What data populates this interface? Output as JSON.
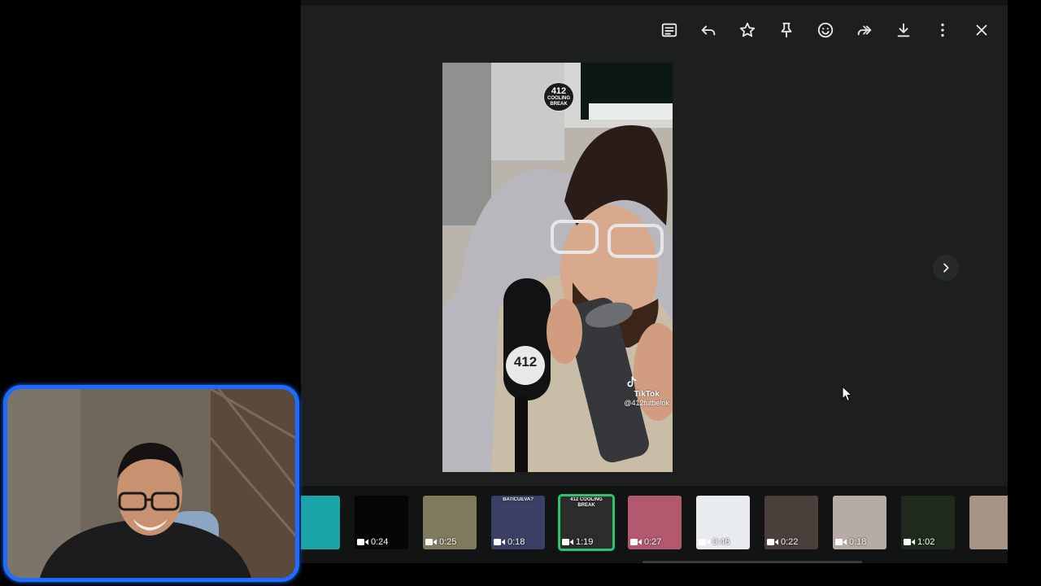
{
  "toolbar": {
    "items": [
      {
        "name": "caption-icon",
        "label": "Caption"
      },
      {
        "name": "reply-icon",
        "label": "Reply"
      },
      {
        "name": "star-icon",
        "label": "Star"
      },
      {
        "name": "pin-icon",
        "label": "Pin"
      },
      {
        "name": "react-icon",
        "label": "React"
      },
      {
        "name": "forward-icon",
        "label": "Forward"
      },
      {
        "name": "download-icon",
        "label": "Download"
      },
      {
        "name": "more-icon",
        "label": "More options"
      },
      {
        "name": "close-icon",
        "label": "Close"
      }
    ]
  },
  "main_video": {
    "logo_number": "412",
    "logo_text": "COOLING BREAK",
    "mic_label": "412",
    "watermark_brand": "TikTok",
    "watermark_handle": "@412futbelok"
  },
  "thumbnails": [
    {
      "duration": "",
      "caption": "",
      "bg": "#1aa6a8"
    },
    {
      "duration": "0:24",
      "caption": "",
      "bg": "#050505"
    },
    {
      "duration": "0:25",
      "caption": "",
      "bg": "#7f7a5d"
    },
    {
      "duration": "0:18",
      "caption": "BATICUEVA?",
      "bg": "#3a3f66"
    },
    {
      "duration": "1:19",
      "caption": "412 COOLING BREAK",
      "bg": "#2c2c2c",
      "selected": true
    },
    {
      "duration": "0:27",
      "caption": "",
      "bg": "#b2586f"
    },
    {
      "duration": "0:46",
      "caption": "",
      "bg": "#e9ecef"
    },
    {
      "duration": "0:22",
      "caption": "",
      "bg": "#4a3f3b"
    },
    {
      "duration": "0:18",
      "caption": "",
      "bg": "#b6aca3"
    },
    {
      "duration": "1:02",
      "caption": "",
      "bg": "#1f2a1c"
    },
    {
      "duration": "",
      "caption": "",
      "bg": "#a79485"
    },
    {
      "duration": "",
      "caption": "",
      "bg": "#3c3f62"
    }
  ],
  "colors": {
    "viewer_bg": "#1c1f1e",
    "selected_outline": "#28c76f",
    "webcam_border": "#1e6bff"
  }
}
